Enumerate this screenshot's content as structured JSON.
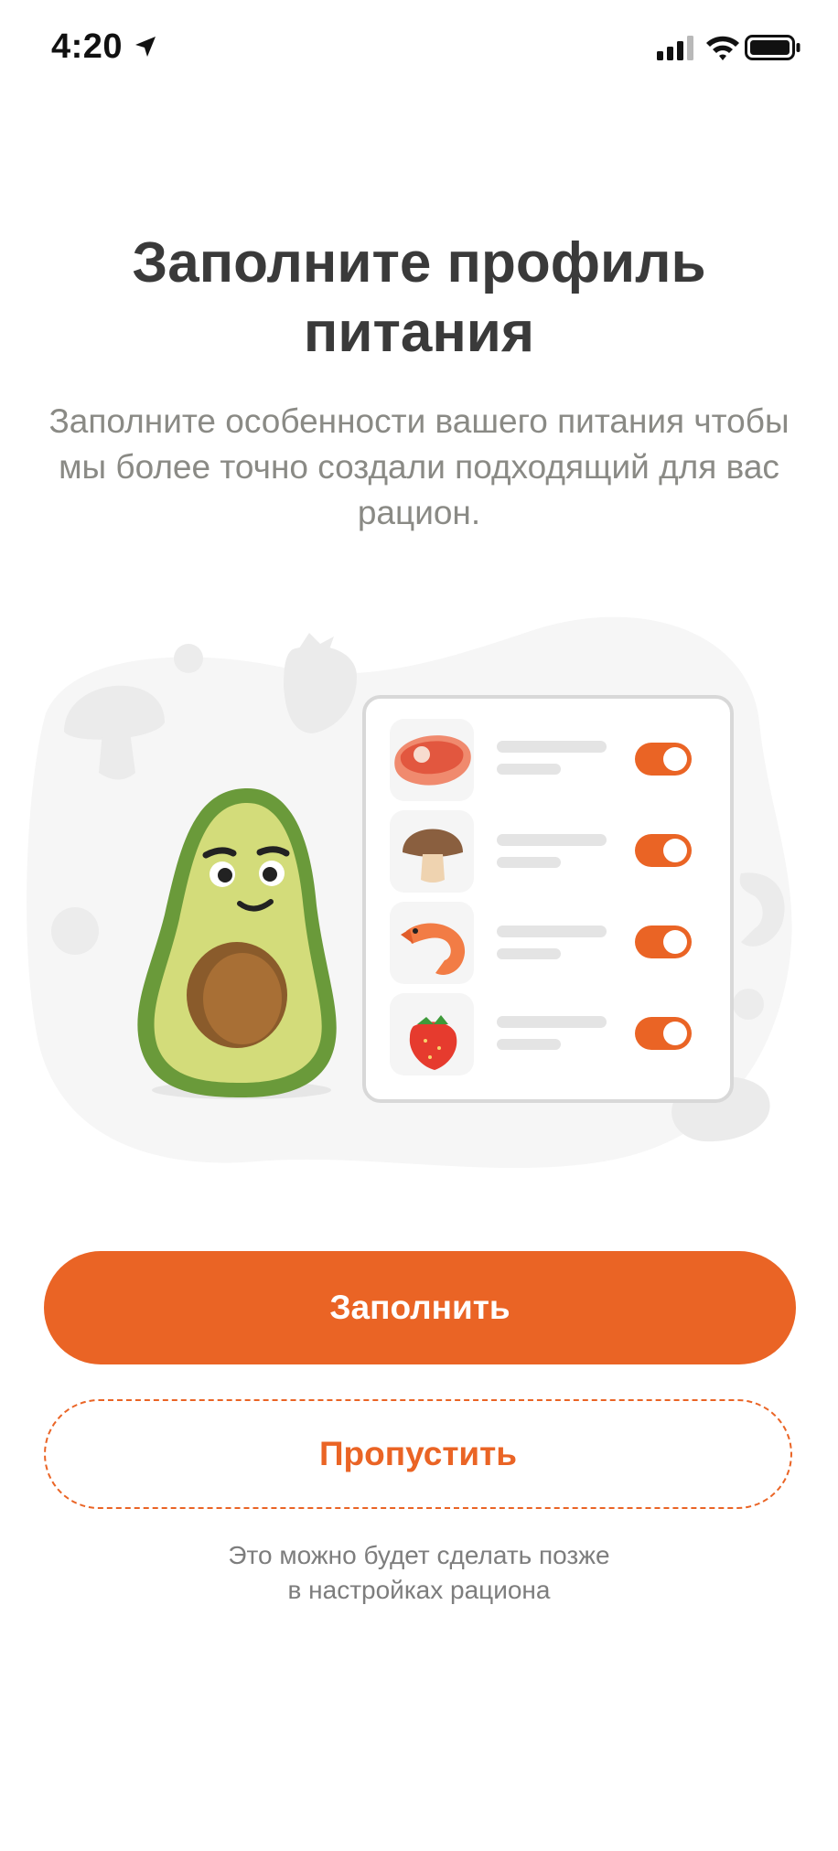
{
  "status_bar": {
    "time": "4:20",
    "icons": [
      "location-arrow-icon",
      "cellular-signal-icon",
      "wifi-icon",
      "battery-icon"
    ]
  },
  "onboarding": {
    "title": "Заполните профиль питания",
    "subtitle": "Заполните особенности вашего питания чтобы мы более точно создали подходящий для вас рацион.",
    "illustration": {
      "character": "avocado-character",
      "list_items": [
        {
          "icon": "meat-icon",
          "toggle_on": true
        },
        {
          "icon": "mushroom-icon",
          "toggle_on": true
        },
        {
          "icon": "shrimp-icon",
          "toggle_on": true
        },
        {
          "icon": "strawberry-icon",
          "toggle_on": true
        }
      ]
    },
    "primary_button": "Заполнить",
    "secondary_button": "Пропустить",
    "hint_line1": "Это можно будет сделать позже",
    "hint_line2": "в настройках рациона"
  },
  "colors": {
    "accent": "#ea6425",
    "title": "#3a3a3a",
    "subtitle": "#8a8a85",
    "hint": "#7d7d7d"
  }
}
